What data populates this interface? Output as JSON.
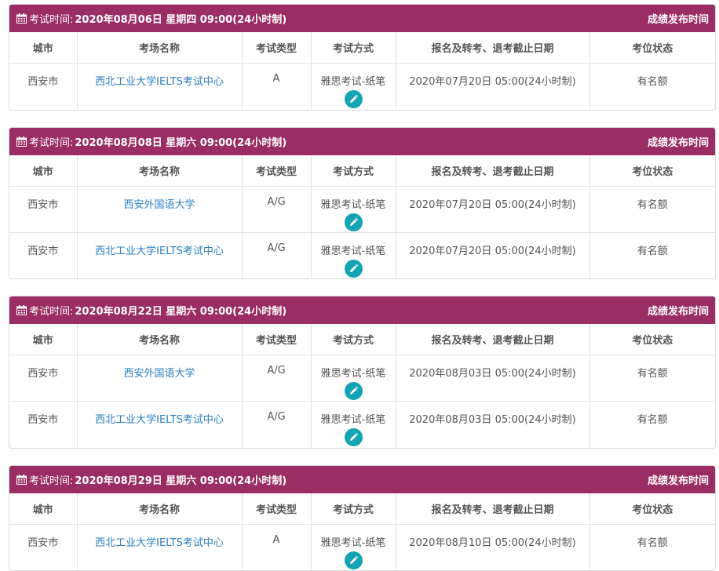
{
  "columns": [
    "城市",
    "考场名称",
    "考试类型",
    "考试方式",
    "报名及转考、退考截止日期",
    "考位状态"
  ],
  "header_label": "考试时间:",
  "header_right": "成绩发布时间",
  "sessions": [
    {
      "date": "2020年08月06日 星期四 09:00(24小时制)",
      "rows": [
        {
          "city": "西安市",
          "venue": "西北工业大学IELTS考试中心",
          "type": "A",
          "mode": "雅思考试-纸笔",
          "deadline": "2020年07月20日 05:00(24小时制)",
          "status": "有名额"
        }
      ]
    },
    {
      "date": "2020年08月08日 星期六 09:00(24小时制)",
      "rows": [
        {
          "city": "西安市",
          "venue": "西安外国语大学",
          "type": "A/G",
          "mode": "雅思考试-纸笔",
          "deadline": "2020年07月20日 05:00(24小时制)",
          "status": "有名额"
        },
        {
          "city": "西安市",
          "venue": "西北工业大学IELTS考试中心",
          "type": "A/G",
          "mode": "雅思考试-纸笔",
          "deadline": "2020年07月20日 05:00(24小时制)",
          "status": "有名额"
        }
      ]
    },
    {
      "date": "2020年08月22日 星期六 09:00(24小时制)",
      "rows": [
        {
          "city": "西安市",
          "venue": "西安外国语大学",
          "type": "A/G",
          "mode": "雅思考试-纸笔",
          "deadline": "2020年08月03日 05:00(24小时制)",
          "status": "有名额"
        },
        {
          "city": "西安市",
          "venue": "西北工业大学IELTS考试中心",
          "type": "A/G",
          "mode": "雅思考试-纸笔",
          "deadline": "2020年08月03日 05:00(24小时制)",
          "status": "有名额"
        }
      ]
    },
    {
      "date": "2020年08月29日 星期六 09:00(24小时制)",
      "rows": [
        {
          "city": "西安市",
          "venue": "西北工业大学IELTS考试中心",
          "type": "A",
          "mode": "雅思考试-纸笔",
          "deadline": "2020年08月10日 05:00(24小时制)",
          "status": "有名额"
        }
      ]
    }
  ],
  "colors": {
    "header_bg": "#9a2d63",
    "link": "#2a7fc0",
    "edit_button": "#12a4b2"
  },
  "icons": {
    "header": "calendar-icon",
    "mode_action": "pencil-icon"
  }
}
